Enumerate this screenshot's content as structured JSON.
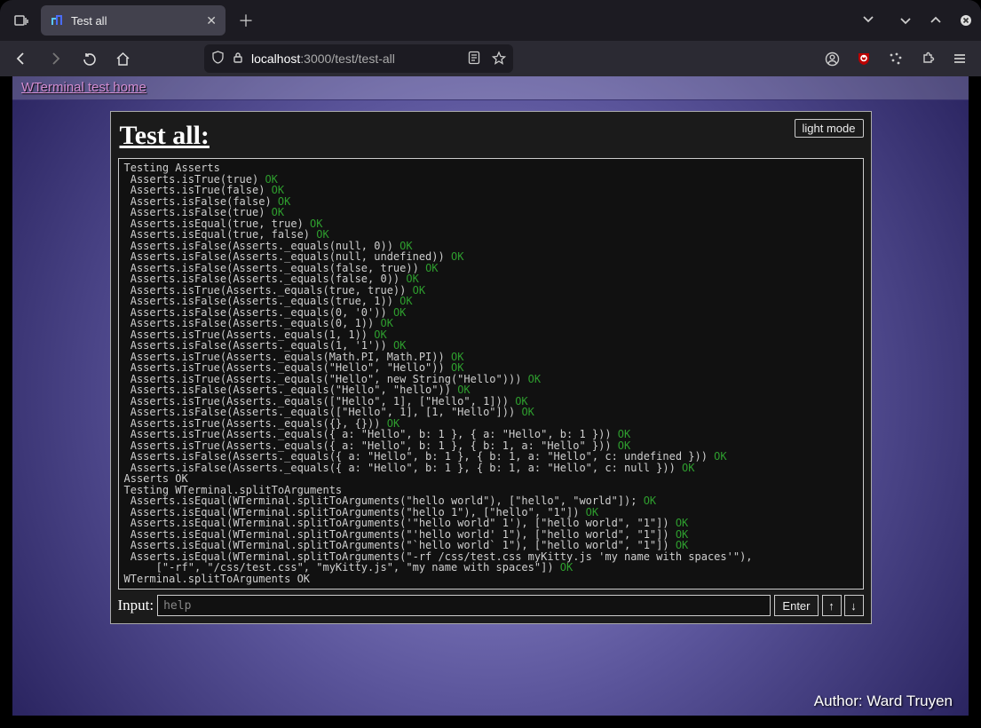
{
  "browser": {
    "tab_title": "Test all",
    "url_host": "localhost",
    "url_port_path": ":3000/test/test-all",
    "dropdown_icon": "chevron-down"
  },
  "page": {
    "home_link": "WTerminal test home",
    "title": "Test all:",
    "lightmode_label": "light mode",
    "input_label": "Input:",
    "input_placeholder": "help",
    "enter_label": "Enter",
    "up_label": "↑",
    "down_label": "↓",
    "author": "Author: Ward Truyen"
  },
  "terminal": {
    "lines": [
      {
        "indent": 0,
        "text": "Testing Asserts"
      },
      {
        "indent": 1,
        "text": "Asserts.isTrue(true) ",
        "ok": "OK"
      },
      {
        "indent": 1,
        "text": "Asserts.isTrue(false) ",
        "ok": "OK"
      },
      {
        "indent": 1,
        "text": "Asserts.isFalse(false) ",
        "ok": "OK"
      },
      {
        "indent": 1,
        "text": "Asserts.isFalse(true) ",
        "ok": "OK"
      },
      {
        "indent": 1,
        "text": "Asserts.isEqual(true, true) ",
        "ok": "OK"
      },
      {
        "indent": 1,
        "text": "Asserts.isEqual(true, false) ",
        "ok": "OK"
      },
      {
        "indent": 1,
        "text": "Asserts.isFalse(Asserts._equals(null, 0)) ",
        "ok": "OK"
      },
      {
        "indent": 1,
        "text": "Asserts.isFalse(Asserts._equals(null, undefined)) ",
        "ok": "OK"
      },
      {
        "indent": 1,
        "text": "Asserts.isFalse(Asserts._equals(false, true)) ",
        "ok": "OK"
      },
      {
        "indent": 1,
        "text": "Asserts.isFalse(Asserts._equals(false, 0)) ",
        "ok": "OK"
      },
      {
        "indent": 1,
        "text": "Asserts.isTrue(Asserts._equals(true, true)) ",
        "ok": "OK"
      },
      {
        "indent": 1,
        "text": "Asserts.isFalse(Asserts._equals(true, 1)) ",
        "ok": "OK"
      },
      {
        "indent": 1,
        "text": "Asserts.isFalse(Asserts._equals(0, '0')) ",
        "ok": "OK"
      },
      {
        "indent": 1,
        "text": "Asserts.isFalse(Asserts._equals(0, 1)) ",
        "ok": "OK"
      },
      {
        "indent": 1,
        "text": "Asserts.isTrue(Asserts._equals(1, 1)) ",
        "ok": "OK"
      },
      {
        "indent": 1,
        "text": "Asserts.isFalse(Asserts._equals(1, '1')) ",
        "ok": "OK"
      },
      {
        "indent": 1,
        "text": "Asserts.isTrue(Asserts._equals(Math.PI, Math.PI)) ",
        "ok": "OK"
      },
      {
        "indent": 1,
        "text": "Asserts.isTrue(Asserts._equals(\"Hello\", \"Hello\")) ",
        "ok": "OK"
      },
      {
        "indent": 1,
        "text": "Asserts.isTrue(Asserts._equals(\"Hello\", new String(\"Hello\"))) ",
        "ok": "OK"
      },
      {
        "indent": 1,
        "text": "Asserts.isFalse(Asserts._equals(\"Hello\", \"hello\")) ",
        "ok": "OK"
      },
      {
        "indent": 1,
        "text": "Asserts.isTrue(Asserts._equals([\"Hello\", 1], [\"Hello\", 1])) ",
        "ok": "OK"
      },
      {
        "indent": 1,
        "text": "Asserts.isFalse(Asserts._equals([\"Hello\", 1], [1, \"Hello\"])) ",
        "ok": "OK"
      },
      {
        "indent": 1,
        "text": "Asserts.isTrue(Asserts._equals({}, {})) ",
        "ok": "OK"
      },
      {
        "indent": 1,
        "text": "Asserts.isTrue(Asserts._equals({ a: \"Hello\", b: 1 }, { a: \"Hello\", b: 1 })) ",
        "ok": "OK"
      },
      {
        "indent": 1,
        "text": "Asserts.isTrue(Asserts._equals({ a: \"Hello\", b: 1 }, { b: 1, a: \"Hello\" })) ",
        "ok": "OK"
      },
      {
        "indent": 1,
        "text": "Asserts.isFalse(Asserts._equals({ a: \"Hello\", b: 1 }, { b: 1, a: \"Hello\", c: undefined })) ",
        "ok": "OK"
      },
      {
        "indent": 1,
        "text": "Asserts.isFalse(Asserts._equals({ a: \"Hello\", b: 1 }, { b: 1, a: \"Hello\", c: null })) ",
        "ok": "OK"
      },
      {
        "indent": 0,
        "text": "Asserts OK"
      },
      {
        "indent": 0,
        "text": "Testing WTerminal.splitToArguments"
      },
      {
        "indent": 1,
        "text": "Asserts.isEqual(WTerminal.splitToArguments(\"hello world\"), [\"hello\", \"world\"]); ",
        "ok": "OK"
      },
      {
        "indent": 1,
        "text": "Asserts.isEqual(WTerminal.splitToArguments(\"hello 1\"), [\"hello\", \"1\"]) ",
        "ok": "OK"
      },
      {
        "indent": 1,
        "text": "Asserts.isEqual(WTerminal.splitToArguments('\"hello world\" 1'), [\"hello world\", \"1\"]) ",
        "ok": "OK"
      },
      {
        "indent": 1,
        "text": "Asserts.isEqual(WTerminal.splitToArguments(\"'hello world' 1\"), [\"hello world\", \"1\"]) ",
        "ok": "OK"
      },
      {
        "indent": 1,
        "text": "Asserts.isEqual(WTerminal.splitToArguments(\"`hello world` 1\"), [\"hello world\", \"1\"]) ",
        "ok": "OK"
      },
      {
        "indent": 1,
        "text": "Asserts.isEqual(WTerminal.splitToArguments(\"-rf /css/test.css myKitty.js 'my name with spaces'\"),"
      },
      {
        "indent": 0,
        "text": "     [\"-rf\", \"/css/test.css\", \"myKitty.js\", \"my name with spaces\"]) ",
        "ok": "OK"
      },
      {
        "indent": 0,
        "text": "WTerminal.splitToArguments OK"
      }
    ]
  }
}
